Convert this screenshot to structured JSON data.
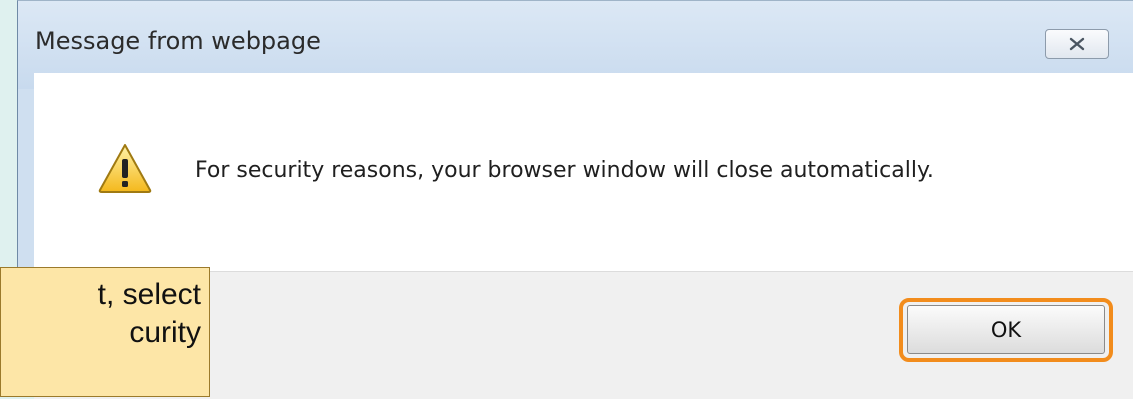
{
  "dialog": {
    "title": "Message from webpage",
    "close_icon": "close-icon",
    "warning_icon": "warning-icon",
    "message": "For security reasons, your browser window will close automatically.",
    "ok_label": "OK"
  },
  "callout": {
    "line1": "t, select",
    "line2": "curity"
  },
  "colors": {
    "highlight": "#f28c1c",
    "callout_bg": "#fde6a7",
    "background": "#dff1ef"
  }
}
